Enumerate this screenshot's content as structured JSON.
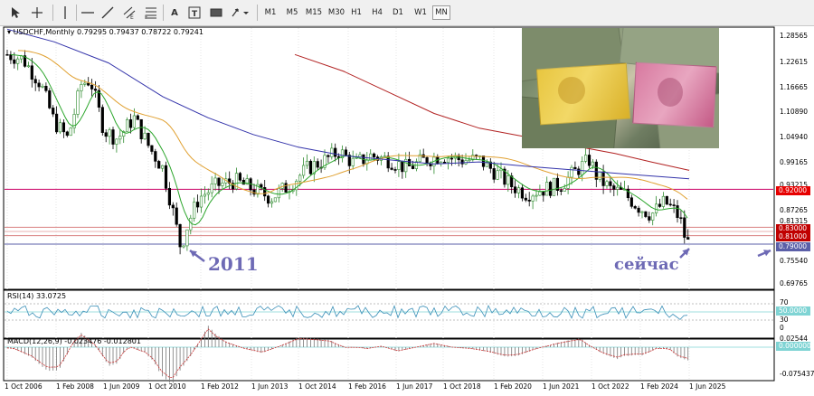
{
  "toolbar": {
    "timeframes": [
      "M1",
      "M5",
      "M15",
      "M30",
      "H1",
      "H4",
      "D1",
      "W1",
      "MN"
    ],
    "active_timeframe": "MN"
  },
  "chart": {
    "symbol_label": "USDCHF,Monthly",
    "ohlc": "0.79295 0.79437 0.78722 0.79241",
    "price_ticks": [
      "1.28565",
      "1.22615",
      "1.16665",
      "1.10890",
      "1.04940",
      "0.99165",
      "0.93215",
      "0.87265",
      "0.81315",
      "0.75540",
      "0.69765"
    ],
    "price_tags": [
      {
        "value": "0.92000",
        "color": "#e60000"
      },
      {
        "value": "0.83000",
        "color": "#c00000"
      },
      {
        "value": "0.81000",
        "color": "#c00000"
      },
      {
        "value": "0.79000",
        "color": "#5b5fa8"
      }
    ],
    "date_ticks": [
      "1 Oct 2006",
      "1 Feb 2008",
      "1 Jun 2009",
      "1 Oct 2010",
      "1 Feb 2012",
      "1 Jun 2013",
      "1 Oct 2014",
      "1 Feb 2016",
      "1 Jun 2017",
      "1 Oct 2018",
      "1 Feb 2020",
      "1 Jun 2021",
      "1 Oct 2022",
      "1 Feb 2024",
      "1 Jun 2025"
    ],
    "annotation_2011": "2011",
    "annotation_now": "сейчас"
  },
  "rsi": {
    "label": "RSI(14) 33.0725",
    "levels": [
      "70",
      "50.0000",
      "30",
      "0"
    ]
  },
  "macd": {
    "label": "MACD(12,26,9) -0.023476 -0.012801",
    "ticks": [
      "0.02544",
      "0.000000",
      "-0.075437"
    ]
  },
  "colors": {
    "bull_candle": "#2e8b2e",
    "bear_candle": "#000000",
    "ma_fast": "#2aa52a",
    "ma_mid": "#e0a030",
    "ma_slow": "#3333aa",
    "ma_long": "#b22222",
    "resistance": "#cc0066",
    "annotation": "#6e6ab5"
  }
}
